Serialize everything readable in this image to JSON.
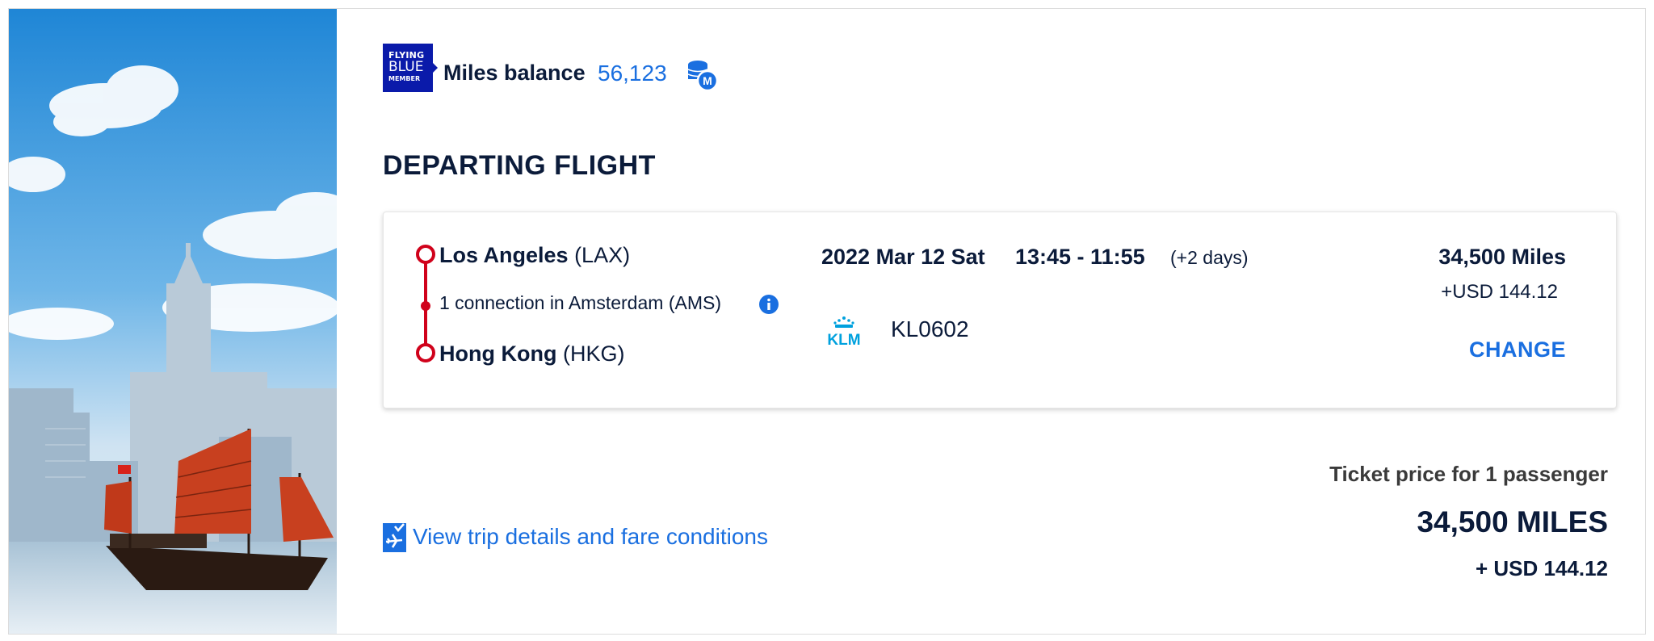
{
  "loyalty": {
    "logo_line1": "FLYING",
    "logo_line2": "BLUE",
    "logo_line3": "MEMBER",
    "balance_label": "Miles balance",
    "balance_value": "56,123",
    "balance_icon": "miles-coins-icon"
  },
  "section_title": "DEPARTING FLIGHT",
  "flight": {
    "origin_city": "Los Angeles",
    "origin_code": "(LAX)",
    "connection": "1 connection in Amsterdam (AMS)",
    "destination_city": "Hong Kong",
    "destination_code": "(HKG)",
    "date": "2022 Mar 12 Sat",
    "times": "13:45 - 11:55",
    "day_offset": "(+2 days)",
    "airline_logo_text": "KLM",
    "flight_number": "KL0602",
    "price_miles": "34,500 Miles",
    "price_usd": "+USD 144.12",
    "change_label": "CHANGE"
  },
  "details_link": "View trip details and fare conditions",
  "ticket": {
    "label": "Ticket price for 1 passenger",
    "miles": "34,500 MILES",
    "usd": "+ USD 144.12"
  },
  "colors": {
    "navy": "#0b1b3a",
    "link_blue": "#1a6fe0",
    "route_red": "#d0021b",
    "flying_blue": "#0a1aaa",
    "klm_blue": "#00a1de"
  }
}
